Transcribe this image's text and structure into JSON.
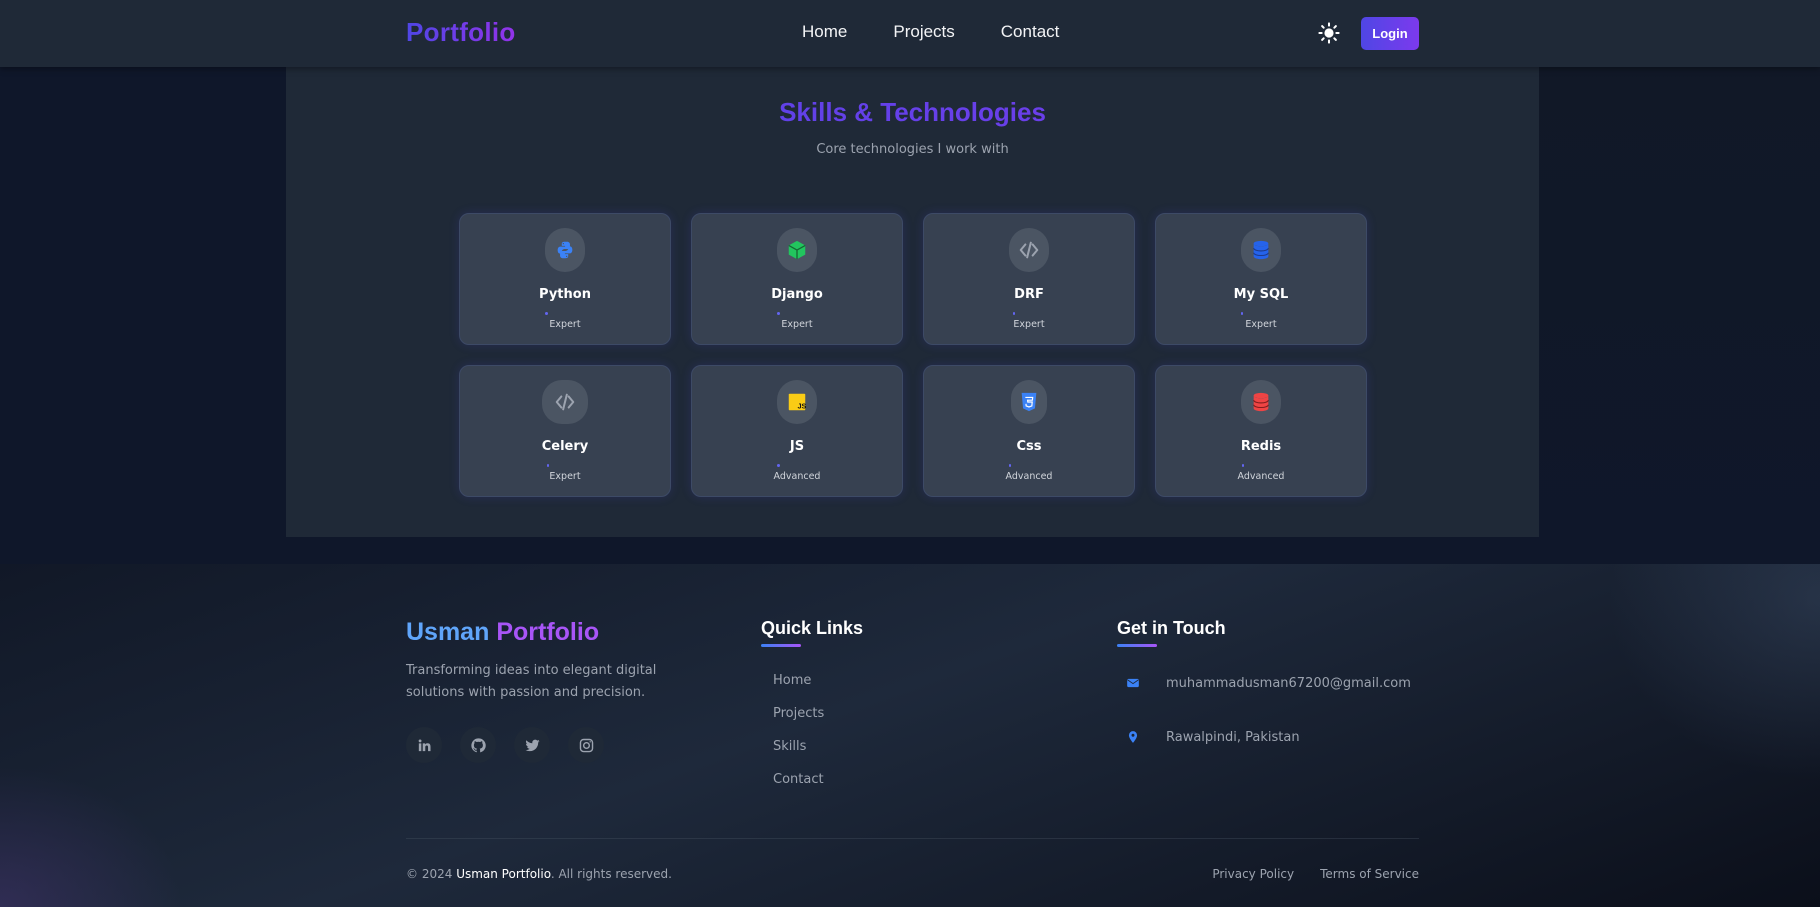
{
  "nav": {
    "brand": "Portfolio",
    "links": [
      "Home",
      "Projects",
      "Contact"
    ],
    "theme_icon": "sun-icon",
    "login_label": "Login"
  },
  "skills": {
    "title": "Skills & Technologies",
    "subtitle": "Core technologies I work with",
    "items": [
      {
        "name": "Python",
        "level": "Expert",
        "icon": "python-icon",
        "icon_color": "#3b82f6"
      },
      {
        "name": "Django",
        "level": "Expert",
        "icon": "cube-icon",
        "icon_color": "#22c55e"
      },
      {
        "name": "DRF",
        "level": "Expert",
        "icon": "code-icon",
        "icon_color": "#9ca3af"
      },
      {
        "name": "My SQL",
        "level": "Expert",
        "icon": "database-icon",
        "icon_color": "#2563eb"
      },
      {
        "name": "Celery",
        "level": "Expert",
        "icon": "code-icon",
        "icon_color": "#9ca3af"
      },
      {
        "name": "JS",
        "level": "Advanced",
        "icon": "js-icon",
        "icon_color": "#facc15"
      },
      {
        "name": "Css",
        "level": "Advanced",
        "icon": "css3-icon",
        "icon_color": "#3b82f6"
      },
      {
        "name": "Redis",
        "level": "Advanced",
        "icon": "database-icon",
        "icon_color": "#ef4444"
      }
    ]
  },
  "footer": {
    "brand_first": "Usman",
    "brand_second": "Portfolio",
    "description": "Transforming ideas into elegant digital solutions with passion and precision.",
    "socials": [
      "linkedin-icon",
      "github-icon",
      "twitter-icon",
      "instagram-icon"
    ],
    "quick_links_title": "Quick Links",
    "quick_links": [
      "Home",
      "Projects",
      "Skills",
      "Contact"
    ],
    "contact_title": "Get in Touch",
    "email": "muhammadusman67200@gmail.com",
    "location": "Rawalpindi, Pakistan",
    "copyright_prefix": "© 2024",
    "copyright_name": "Usman Portfolio",
    "copyright_suffix": ". All rights reserved.",
    "privacy": "Privacy Policy",
    "terms": "Terms of Service"
  },
  "colors": {
    "accent": "#4f46e5",
    "accent_purple": "#9333ea",
    "card_bg": "#374151",
    "section_bg": "#1f2937"
  }
}
